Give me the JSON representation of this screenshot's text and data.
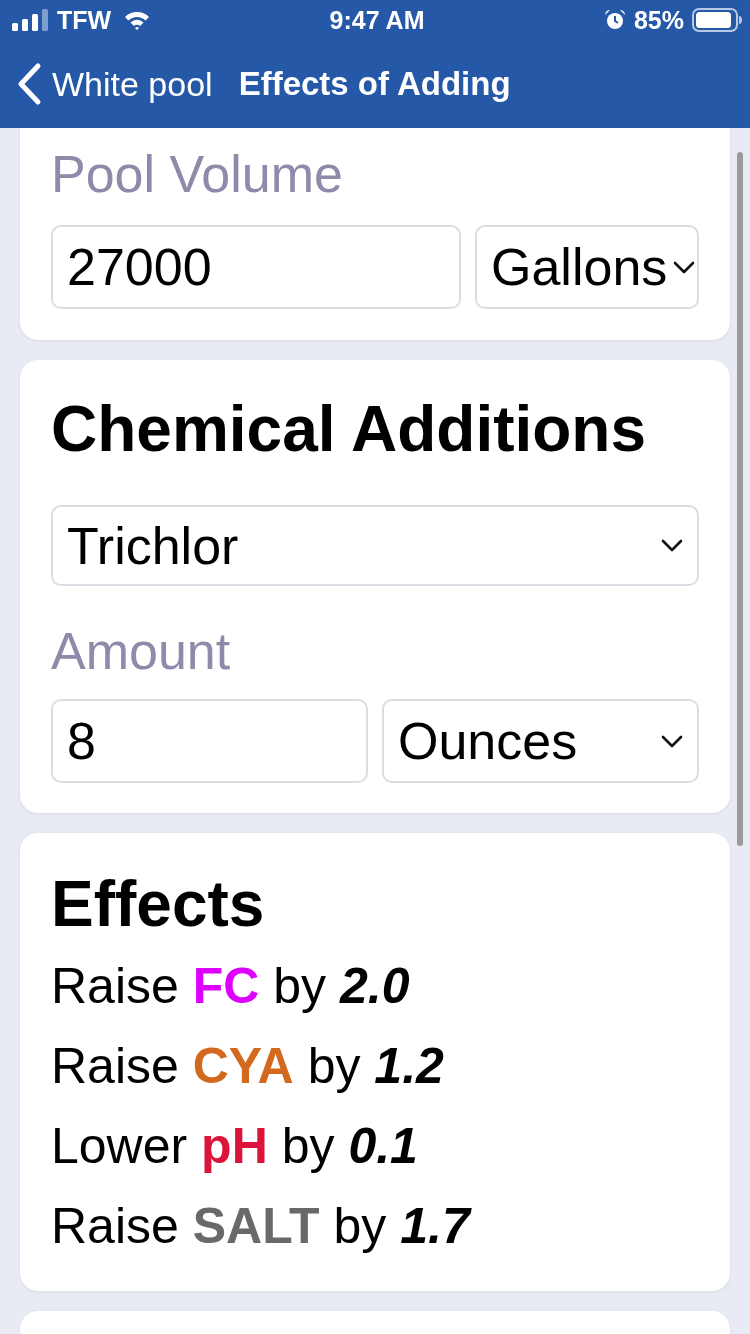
{
  "status_bar": {
    "carrier": "TFW",
    "time": "9:47 AM",
    "battery": "85%"
  },
  "nav_bar": {
    "back_label": "White pool",
    "title": "Effects of Adding"
  },
  "pool_volume": {
    "label": "Pool Volume",
    "value": "27000",
    "unit": "Gallons"
  },
  "chemical_additions": {
    "title": "Chemical Additions",
    "chemical": "Trichlor",
    "amount_label": "Amount",
    "amount": "8",
    "amount_unit": "Ounces"
  },
  "effects": {
    "title": "Effects",
    "items": [
      {
        "verb": "Raise",
        "parameter": "FC",
        "color": "#dd00ff",
        "connector": "by",
        "amount": "2.0"
      },
      {
        "verb": "Raise",
        "parameter": "CYA",
        "color": "#d2691e",
        "connector": "by",
        "amount": "1.2"
      },
      {
        "verb": "Lower",
        "parameter": "pH",
        "color": "#dc143c",
        "connector": "by",
        "amount": "0.1"
      },
      {
        "verb": "Raise",
        "parameter": "SALT",
        "color": "#696969",
        "connector": "by",
        "amount": "1.7"
      }
    ]
  }
}
